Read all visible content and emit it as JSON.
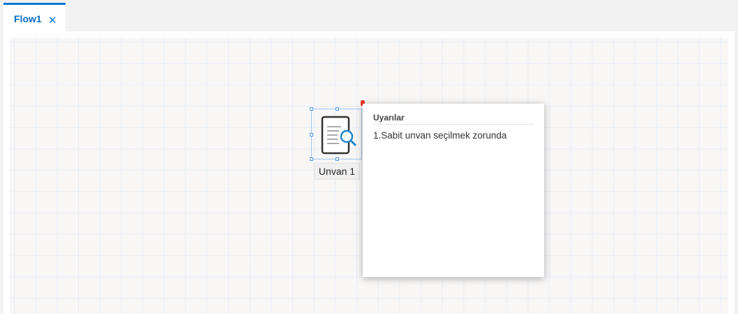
{
  "tabs": [
    {
      "label": "Flow1",
      "active": true
    }
  ],
  "node": {
    "label": "Unvan 1",
    "icon": "document-search-icon"
  },
  "popup": {
    "title": "Uyarılar",
    "messages": [
      "1.Sabit unvan seçilmek zorunda"
    ]
  },
  "colors": {
    "accent": "#0a78d4",
    "error": "#e53b2c"
  }
}
